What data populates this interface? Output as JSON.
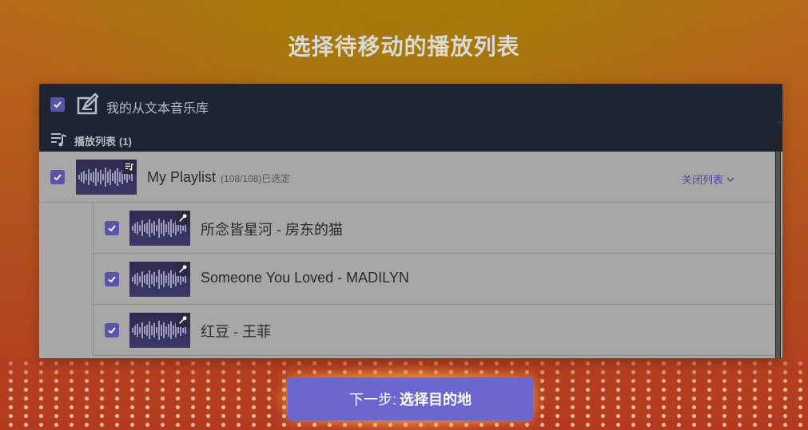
{
  "title": "选择待移动的播放列表",
  "library": {
    "label": "我的从文本音乐库",
    "checked": true,
    "icon": "edit-text-icon"
  },
  "playlists_header": {
    "label": "播放列表",
    "count": "(1)",
    "icon": "playlist-music-icon"
  },
  "playlist": {
    "name": "My Playlist",
    "meta": "(108/108)已选定",
    "collapse_label": "关闭列表",
    "checked": true,
    "thumb_icon": "playlist-icon"
  },
  "tracks": [
    {
      "title": "所念皆星河 - 房东的猫",
      "checked": true,
      "thumb_icon": "microphone-icon"
    },
    {
      "title": "Someone You Loved - MADILYN",
      "checked": true,
      "thumb_icon": "microphone-icon"
    },
    {
      "title": "红豆 - 王菲",
      "checked": true,
      "thumb_icon": "microphone-icon"
    }
  ],
  "next_button": {
    "prefix": "下一步:",
    "label": "选择目的地"
  },
  "colors": {
    "accent": "#6c66cf",
    "checkbox": "#5a55a8",
    "panel_header": "#1e2434",
    "panel_body": "#a7a7a7"
  }
}
